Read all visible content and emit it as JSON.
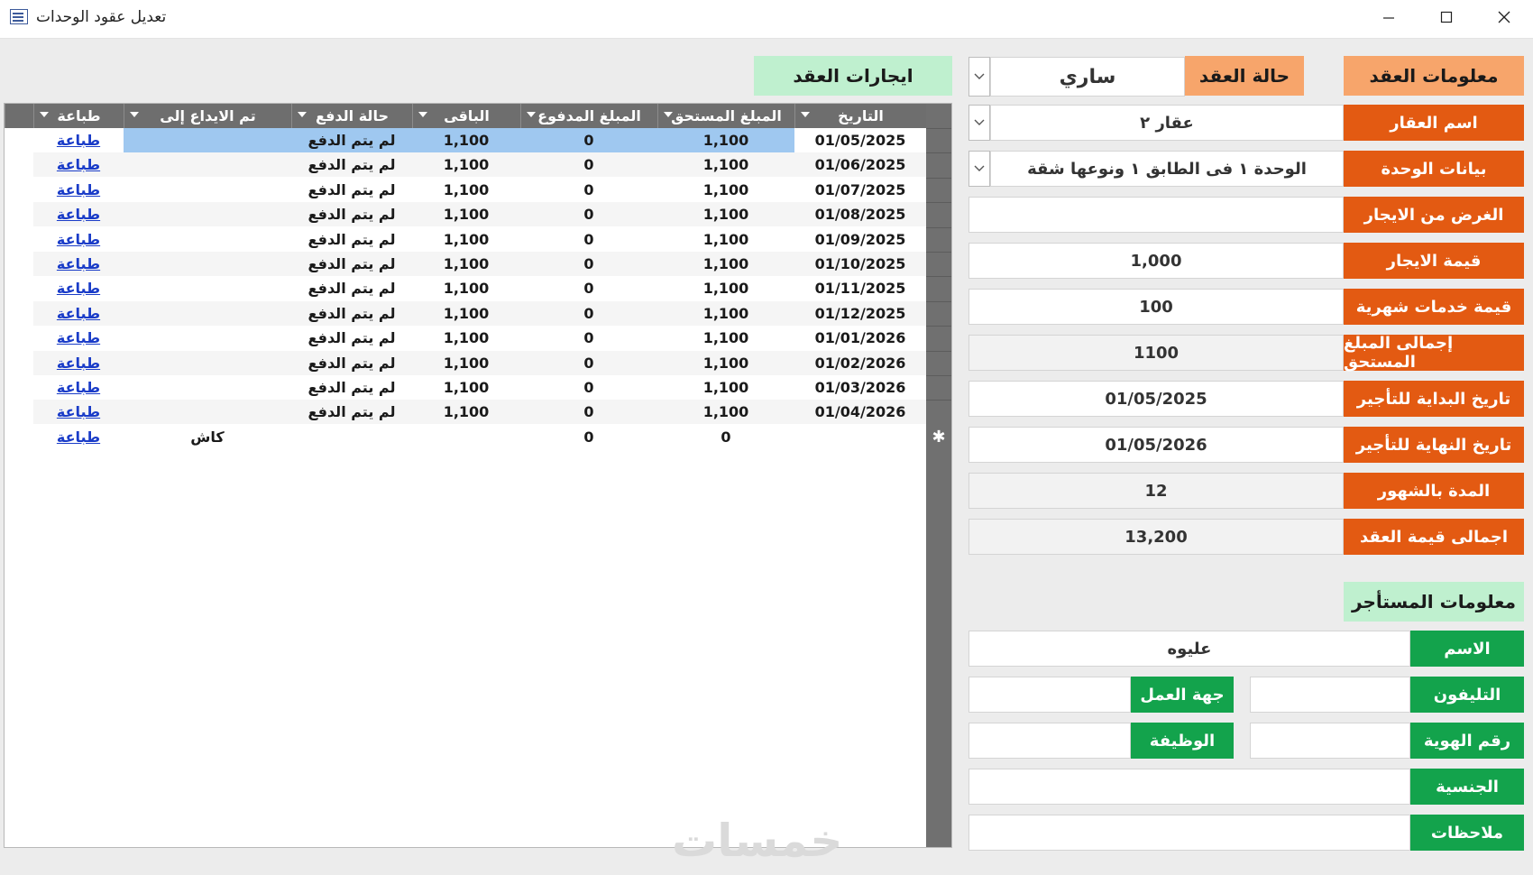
{
  "window": {
    "title": "تعديل عقود الوحدات",
    "controls": [
      "minimize-icon",
      "maximize-icon",
      "close-icon"
    ]
  },
  "contract": {
    "section_title": "معلومات العقد",
    "status_label": "حالة العقد",
    "status_value": "ساري",
    "fields": [
      {
        "label": "اسم العقار",
        "value": "عقار ٢",
        "combo": true
      },
      {
        "label": "بيانات الوحدة",
        "value": "الوحدة ١ فى الطابق ١ ونوعها شقة",
        "combo": true
      },
      {
        "label": "الغرض من الايجار",
        "value": ""
      },
      {
        "label": "قيمة الايجار",
        "value": "1,000"
      },
      {
        "label": "قيمة خدمات شهرية",
        "value": "100"
      },
      {
        "label": "إجمالى المبلغ المستحق",
        "value": "1100",
        "gray": true
      },
      {
        "label": "تاريخ البداية للتأجير",
        "value": "01/05/2025"
      },
      {
        "label": "تاريخ النهاية للتأجير",
        "value": "01/05/2026"
      },
      {
        "label": "المدة بالشهور",
        "value": "12",
        "gray": true
      },
      {
        "label": "اجمالى قيمة العقد",
        "value": "13,200",
        "gray": true
      }
    ]
  },
  "tenant": {
    "section_title": "معلومات المستأجر",
    "name_label": "الاسم",
    "name_value": "عليوه",
    "phone_label": "التليفون",
    "phone_value": "",
    "work_label": "جهة العمل",
    "work_value": "",
    "id_label": "رقم الهوية",
    "id_value": "",
    "job_label": "الوظيفة",
    "job_value": "",
    "nationality_label": "الجنسية",
    "nationality_value": "",
    "notes_label": "ملاحظات",
    "notes_value": ""
  },
  "rents": {
    "section_title": "ايجارات العقد",
    "columns": [
      "التاريخ",
      "المبلغ المستحق",
      "المبلغ المدفوع",
      "الباقى",
      "حالة الدفع",
      "تم الايداع إلى",
      "طباعة"
    ],
    "rows": [
      {
        "date": "01/05/2025",
        "due": "1,100",
        "paid": "0",
        "remaining": "1,100",
        "status": "لم يتم الدفع",
        "deposit": "",
        "print": "طباعة"
      },
      {
        "date": "01/06/2025",
        "due": "1,100",
        "paid": "0",
        "remaining": "1,100",
        "status": "لم يتم الدفع",
        "deposit": "",
        "print": "طباعة"
      },
      {
        "date": "01/07/2025",
        "due": "1,100",
        "paid": "0",
        "remaining": "1,100",
        "status": "لم يتم الدفع",
        "deposit": "",
        "print": "طباعة"
      },
      {
        "date": "01/08/2025",
        "due": "1,100",
        "paid": "0",
        "remaining": "1,100",
        "status": "لم يتم الدفع",
        "deposit": "",
        "print": "طباعة"
      },
      {
        "date": "01/09/2025",
        "due": "1,100",
        "paid": "0",
        "remaining": "1,100",
        "status": "لم يتم الدفع",
        "deposit": "",
        "print": "طباعة"
      },
      {
        "date": "01/10/2025",
        "due": "1,100",
        "paid": "0",
        "remaining": "1,100",
        "status": "لم يتم الدفع",
        "deposit": "",
        "print": "طباعة"
      },
      {
        "date": "01/11/2025",
        "due": "1,100",
        "paid": "0",
        "remaining": "1,100",
        "status": "لم يتم الدفع",
        "deposit": "",
        "print": "طباعة"
      },
      {
        "date": "01/12/2025",
        "due": "1,100",
        "paid": "0",
        "remaining": "1,100",
        "status": "لم يتم الدفع",
        "deposit": "",
        "print": "طباعة"
      },
      {
        "date": "01/01/2026",
        "due": "1,100",
        "paid": "0",
        "remaining": "1,100",
        "status": "لم يتم الدفع",
        "deposit": "",
        "print": "طباعة"
      },
      {
        "date": "01/02/2026",
        "due": "1,100",
        "paid": "0",
        "remaining": "1,100",
        "status": "لم يتم الدفع",
        "deposit": "",
        "print": "طباعة"
      },
      {
        "date": "01/03/2026",
        "due": "1,100",
        "paid": "0",
        "remaining": "1,100",
        "status": "لم يتم الدفع",
        "deposit": "",
        "print": "طباعة"
      },
      {
        "date": "01/04/2026",
        "due": "1,100",
        "paid": "0",
        "remaining": "1,100",
        "status": "لم يتم الدفع",
        "deposit": "",
        "print": "طباعة"
      }
    ],
    "new_row": {
      "date": "",
      "due": "0",
      "paid": "0",
      "remaining": "",
      "status": "",
      "deposit": "كاش",
      "print": "طباعة"
    },
    "new_row_marker": "✱"
  },
  "watermark": "خمسات",
  "colors": {
    "orange_label": "#e35a12",
    "light_orange_header": "#f7a56b",
    "green_label": "#13a34c",
    "light_green_header": "#bff0cf",
    "grid_header": "#6e6e6e",
    "selected_cell": "#9fc8f0",
    "link": "#1a3cc8"
  }
}
